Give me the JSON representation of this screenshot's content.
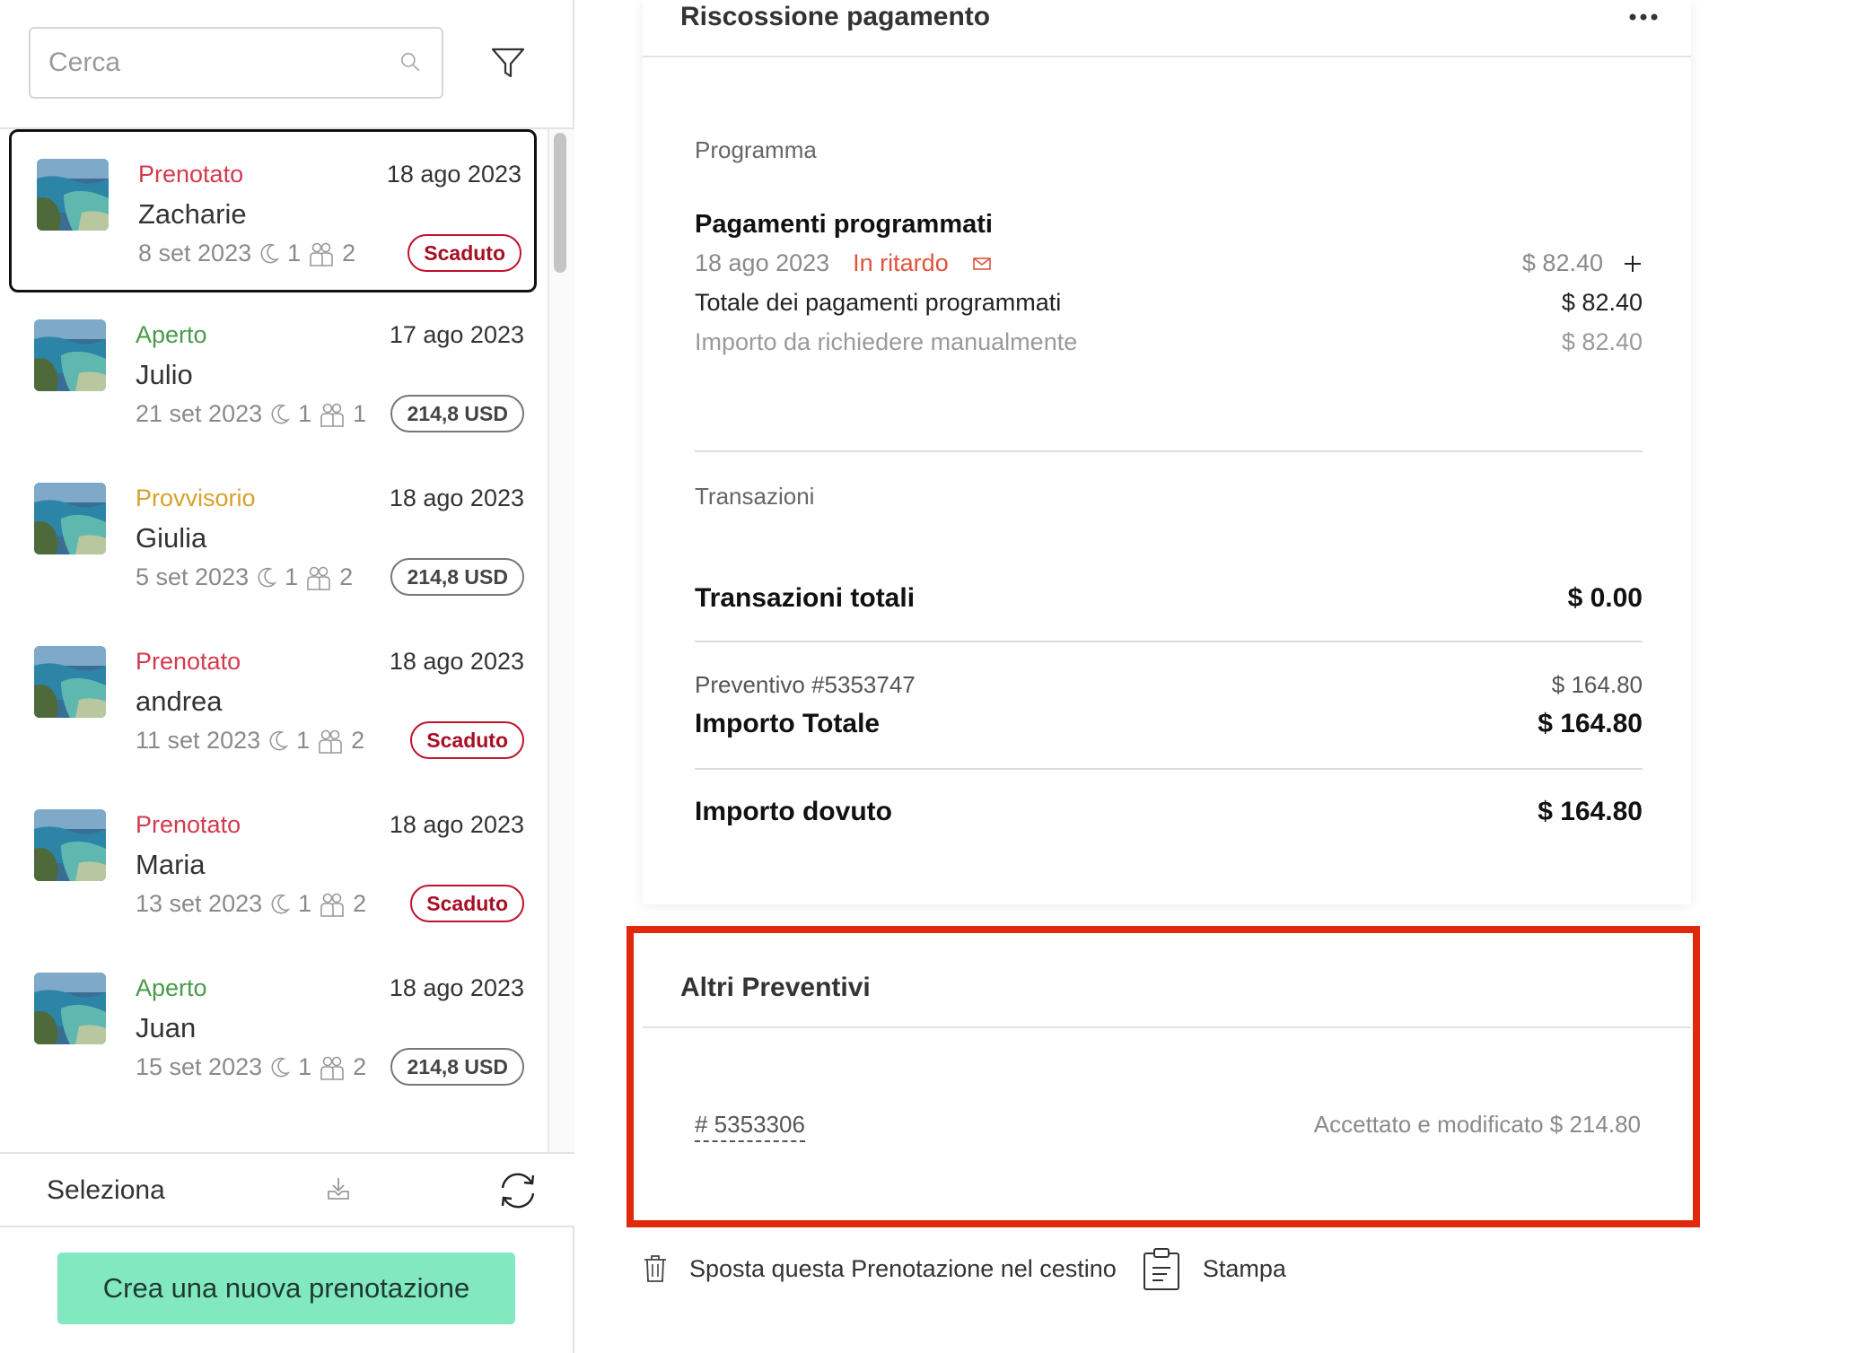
{
  "search": {
    "placeholder": "Cerca"
  },
  "bookings": [
    {
      "status": "Prenotato",
      "status_color": "#d43a4e",
      "date": "18 ago 2023",
      "guest": "Zacharie",
      "checkin": "8 set 2023",
      "nights": "1",
      "guests": "2",
      "badge": "Scaduto",
      "selected": true
    },
    {
      "status": "Aperto",
      "status_color": "#4a9a4a",
      "date": "17 ago 2023",
      "guest": "Julio",
      "checkin": "21 set 2023",
      "nights": "1",
      "guests": "1",
      "badge": "214,8 USD",
      "selected": false
    },
    {
      "status": "Provvisorio",
      "status_color": "#d9a02a",
      "date": "18 ago 2023",
      "guest": "Giulia",
      "checkin": "5 set 2023",
      "nights": "1",
      "guests": "2",
      "badge": "214,8 USD",
      "selected": false
    },
    {
      "status": "Prenotato",
      "status_color": "#d43a4e",
      "date": "18 ago 2023",
      "guest": "andrea",
      "checkin": "11 set 2023",
      "nights": "1",
      "guests": "2",
      "badge": "Scaduto",
      "selected": false
    },
    {
      "status": "Prenotato",
      "status_color": "#d43a4e",
      "date": "18 ago 2023",
      "guest": "Maria",
      "checkin": "13 set 2023",
      "nights": "1",
      "guests": "2",
      "badge": "Scaduto",
      "selected": false
    },
    {
      "status": "Aperto",
      "status_color": "#4a9a4a",
      "date": "18 ago 2023",
      "guest": "Juan",
      "checkin": "15 set 2023",
      "nights": "1",
      "guests": "2",
      "badge": "214,8 USD",
      "selected": false
    }
  ],
  "footer": {
    "select_label": "Seleziona",
    "new_booking_label": "Crea una nuova prenotazione",
    "new_booking_color": "#82e8c0"
  },
  "payment": {
    "title": "Riscossione pagamento",
    "schedule_label": "Programma",
    "scheduled_title": "Pagamenti programmati",
    "scheduled_date": "18 ago 2023",
    "scheduled_status": "In ritardo",
    "scheduled_amount": "$ 82.40",
    "total_scheduled_label": "Totale dei pagamenti programmati",
    "total_scheduled_amount": "$ 82.40",
    "manual_label": "Importo da richiedere manualmente",
    "manual_amount": "$ 82.40",
    "transactions_label": "Transazioni",
    "transactions_total_label": "Transazioni totali",
    "transactions_total_amount": "$ 0.00",
    "quote_label": "Preventivo #5353747",
    "quote_amount": "$ 164.80",
    "total_label": "Importo Totale",
    "total_amount": "$ 164.80",
    "due_label": "Importo dovuto",
    "due_amount": "$ 164.80"
  },
  "other_quotes": {
    "title": "Altri Preventivi",
    "quote_id": "# 5353306",
    "quote_status": "Accettato e modificato $ 214.80",
    "highlight_color": "#e0280c"
  },
  "actions": {
    "trash_label": "Sposta questa Prenotazione nel cestino",
    "print_label": "Stampa"
  }
}
